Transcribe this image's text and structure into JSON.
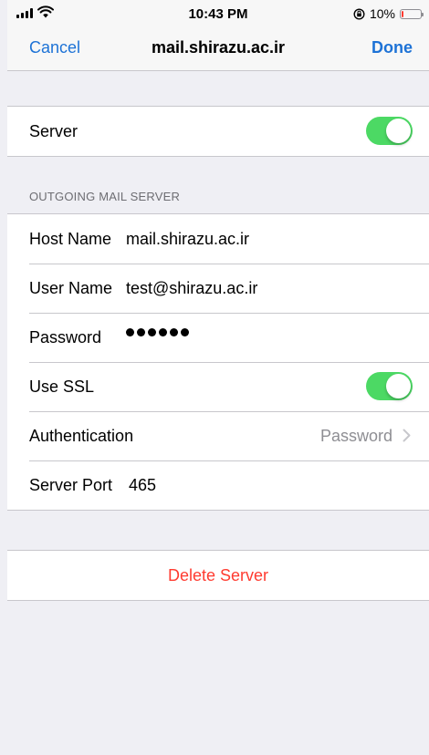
{
  "status_bar": {
    "time": "10:43 PM",
    "battery_percent_label": "10%",
    "battery_level": 0.1,
    "signal_bars": 4,
    "icons": [
      "signal-icon",
      "wifi-icon",
      "orientation-lock-icon",
      "battery-icon"
    ]
  },
  "nav": {
    "cancel_label": "Cancel",
    "title": "mail.shirazu.ac.ir",
    "done_label": "Done"
  },
  "server_group": {
    "server_label": "Server",
    "server_enabled": true
  },
  "outgoing": {
    "section_header": "OUTGOING MAIL SERVER",
    "host_name_label": "Host Name",
    "host_name_value": "mail.shirazu.ac.ir",
    "user_name_label": "User Name",
    "user_name_value": "test@shirazu.ac.ir",
    "password_label": "Password",
    "password_length": 6,
    "use_ssl_label": "Use SSL",
    "use_ssl_enabled": true,
    "authentication_label": "Authentication",
    "authentication_value": "Password",
    "server_port_label": "Server Port",
    "server_port_value": "465"
  },
  "delete": {
    "label": "Delete Server"
  },
  "colors": {
    "accent": "#1d72d6",
    "toggle_on": "#4cd964",
    "destructive": "#ff3b30",
    "background": "#efeff4",
    "secondary_text": "#8e8e93"
  }
}
